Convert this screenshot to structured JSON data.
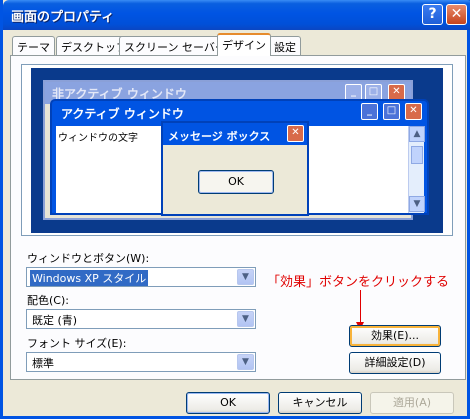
{
  "window": {
    "title": "画面のプロパティ",
    "help_glyph": "?",
    "close_glyph": "✕"
  },
  "tabs": [
    {
      "label": "テーマ"
    },
    {
      "label": "デスクトップ"
    },
    {
      "label": "スクリーン セーバー"
    },
    {
      "label": "デザイン",
      "active": true
    },
    {
      "label": "設定"
    }
  ],
  "preview": {
    "inactive_title": "非アクティブ ウィンドウ",
    "active_title": "アクティブ ウィンドウ",
    "window_text": "ウィンドウの文字",
    "msgbox_title": "メッセージ ボックス",
    "msgbox_ok": "OK"
  },
  "form": {
    "windows_buttons": {
      "label": "ウィンドウとボタン(W):",
      "value": "Windows XP スタイル"
    },
    "color_scheme": {
      "label": "配色(C):",
      "value": "既定 (青)"
    },
    "font_size": {
      "label": "フォント サイズ(E):",
      "value": "標準"
    }
  },
  "buttons": {
    "effects": "効果(E)...",
    "advanced": "詳細設定(D)",
    "ok": "OK",
    "cancel": "キャンセル",
    "apply": "適用(A)"
  },
  "annotation": "「効果」ボタンをクリックする",
  "colors": {
    "accent": "#0054e3",
    "annotation": "#e00000",
    "tab_highlight": "#e68b2c"
  }
}
